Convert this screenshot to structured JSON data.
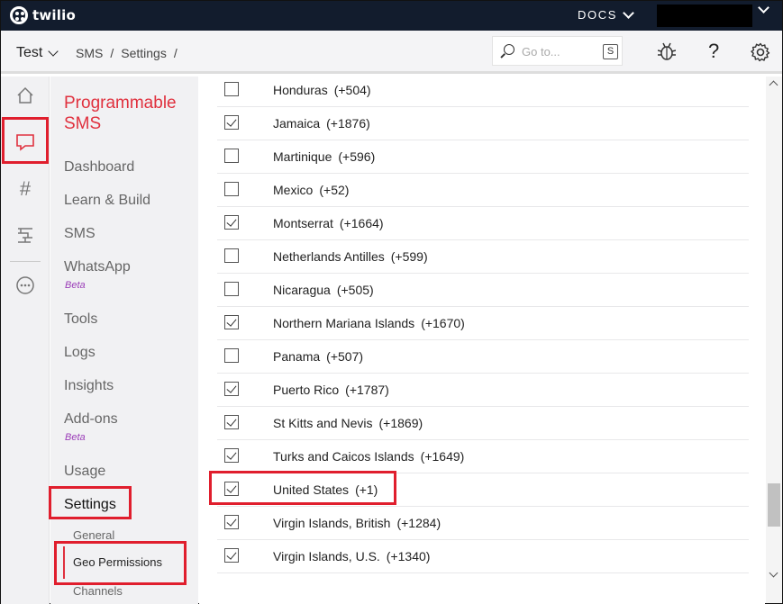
{
  "topbar": {
    "logo": "twilio",
    "docs_label": "DOCS"
  },
  "subbar": {
    "project": "Test",
    "breadcrumbs": [
      "SMS",
      "/",
      "Settings",
      "/"
    ],
    "search_placeholder": "Go to...",
    "search_shortcut": "S",
    "help_label": "?"
  },
  "rail": {
    "icons": [
      "home-icon",
      "chat-icon",
      "hash-icon",
      "flow-icon",
      "more-icon"
    ]
  },
  "menu": {
    "title": "Programmable SMS",
    "items": [
      {
        "label": "Dashboard"
      },
      {
        "label": "Learn & Build"
      },
      {
        "label": "SMS"
      },
      {
        "label": "WhatsApp",
        "badge": "Beta"
      },
      {
        "label": "Tools"
      },
      {
        "label": "Logs"
      },
      {
        "label": "Insights"
      },
      {
        "label": "Add-ons",
        "badge": "Beta"
      },
      {
        "label": "Usage"
      },
      {
        "label": "Settings"
      }
    ],
    "subitems": [
      {
        "label": "General"
      },
      {
        "label": "Geo Permissions"
      },
      {
        "label": "Channels"
      }
    ]
  },
  "countries": [
    {
      "name": "Honduras",
      "code": "(+504)",
      "checked": false
    },
    {
      "name": "Jamaica",
      "code": "(+1876)",
      "checked": true
    },
    {
      "name": "Martinique",
      "code": "(+596)",
      "checked": false
    },
    {
      "name": "Mexico",
      "code": "(+52)",
      "checked": false
    },
    {
      "name": "Montserrat",
      "code": "(+1664)",
      "checked": true
    },
    {
      "name": "Netherlands Antilles",
      "code": "(+599)",
      "checked": false
    },
    {
      "name": "Nicaragua",
      "code": "(+505)",
      "checked": false
    },
    {
      "name": "Northern Mariana Islands",
      "code": "(+1670)",
      "checked": true
    },
    {
      "name": "Panama",
      "code": "(+507)",
      "checked": false
    },
    {
      "name": "Puerto Rico",
      "code": "(+1787)",
      "checked": true
    },
    {
      "name": "St Kitts and Nevis",
      "code": "(+1869)",
      "checked": true
    },
    {
      "name": "Turks and Caicos Islands",
      "code": "(+1649)",
      "checked": true
    },
    {
      "name": "United States",
      "code": "(+1)",
      "checked": true
    },
    {
      "name": "Virgin Islands, British",
      "code": "(+1284)",
      "checked": true
    },
    {
      "name": "Virgin Islands, U.S.",
      "code": "(+1340)",
      "checked": true
    }
  ],
  "colors": {
    "topbar": "#121c2d",
    "accent": "#e0313e",
    "highlight": "#e01e2d",
    "beta": "#9b3eb8"
  }
}
